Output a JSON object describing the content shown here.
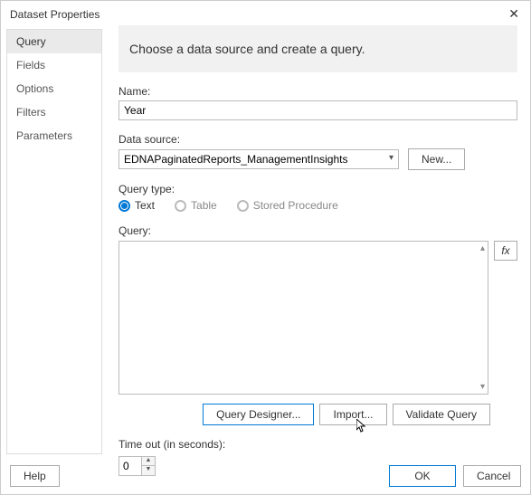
{
  "window": {
    "title": "Dataset Properties"
  },
  "sidebar": {
    "items": [
      {
        "label": "Query"
      },
      {
        "label": "Fields"
      },
      {
        "label": "Options"
      },
      {
        "label": "Filters"
      },
      {
        "label": "Parameters"
      }
    ]
  },
  "main": {
    "heading": "Choose a data source and create a query.",
    "name_label": "Name:",
    "name_value": "Year",
    "datasource_label": "Data source:",
    "datasource_value": "EDNAPaginatedReports_ManagementInsights",
    "new_label": "New...",
    "querytype_label": "Query type:",
    "querytype_options": [
      {
        "label": "Text",
        "selected": true
      },
      {
        "label": "Table",
        "selected": false
      },
      {
        "label": "Stored Procedure",
        "selected": false
      }
    ],
    "query_label": "Query:",
    "query_value": "",
    "fx_label": "fx",
    "buttons": {
      "designer": "Query Designer...",
      "import": "Import...",
      "validate": "Validate Query"
    },
    "timeout_label": "Time out (in seconds):",
    "timeout_value": "0"
  },
  "footer": {
    "help": "Help",
    "ok": "OK",
    "cancel": "Cancel"
  }
}
